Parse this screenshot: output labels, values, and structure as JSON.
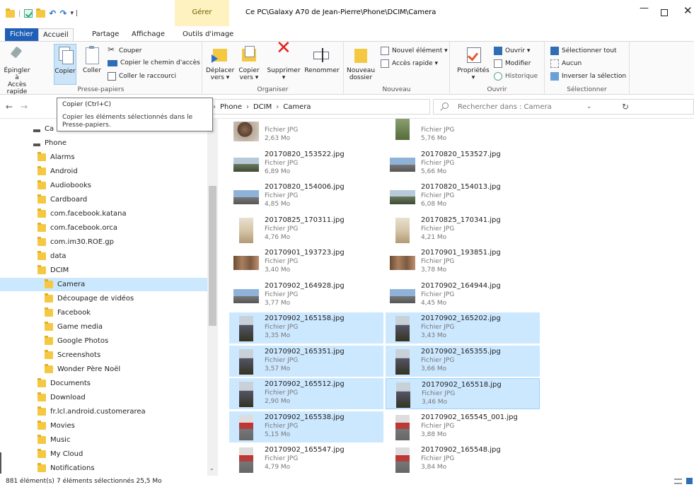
{
  "title_bar": {
    "manage_tab": "Gérer",
    "path_title": "Ce PC\\Galaxy A70 de Jean-Pierre\\Phone\\DCIM\\Camera"
  },
  "tabs": {
    "fichier": "Fichier",
    "accueil": "Accueil",
    "partage": "Partage",
    "affichage": "Affichage",
    "outils_image": "Outils d'image"
  },
  "ribbon": {
    "presse_papiers": {
      "label": "Presse-papiers",
      "epingler": "Épingler à\nAccès rapide",
      "copier": "Copier",
      "coller": "Coller",
      "couper": "Couper",
      "copier_chemin": "Copier le chemin d'accès",
      "coller_raccourci": "Coller le raccourci"
    },
    "organiser": {
      "label": "Organiser",
      "deplacer": "Déplacer\nvers ▾",
      "copier_vers": "Copier\nvers ▾",
      "supprimer": "Supprimer\n▾",
      "renommer": "Renommer"
    },
    "nouveau": {
      "label": "Nouveau",
      "nouveau_dossier": "Nouveau\ndossier",
      "nouvel_element": "Nouvel élément ▾",
      "acces_rapide": "Accès rapide ▾"
    },
    "ouvrir": {
      "label": "Ouvrir",
      "proprietes": "Propriétés\n▾",
      "ouvrir": "Ouvrir ▾",
      "modifier": "Modifier",
      "historique": "Historique"
    },
    "selectionner": {
      "label": "Sélectionner",
      "selectionner_tout": "Sélectionner tout",
      "aucun": "Aucun",
      "inverser": "Inverser la sélection"
    }
  },
  "address": {
    "crumbs": [
      "Phone",
      "DCIM",
      "Camera"
    ],
    "crumb_sep": "›",
    "lead_sep": "›",
    "search_placeholder": "Rechercher dans : Camera"
  },
  "tooltip": {
    "title": "Copier (Ctrl+C)",
    "body": "Copier les éléments sélectionnés dans le Presse-papiers."
  },
  "sidebar": {
    "items": [
      {
        "label": "Ca",
        "kind": "drive"
      },
      {
        "label": "Phone",
        "kind": "drive"
      },
      {
        "label": "Alarms",
        "kind": "folder"
      },
      {
        "label": "Android",
        "kind": "folder"
      },
      {
        "label": "Audiobooks",
        "kind": "folder"
      },
      {
        "label": "Cardboard",
        "kind": "folder"
      },
      {
        "label": "com.facebook.katana",
        "kind": "folder"
      },
      {
        "label": "com.facebook.orca",
        "kind": "folder"
      },
      {
        "label": "com.im30.ROE.gp",
        "kind": "folder"
      },
      {
        "label": "data",
        "kind": "folder"
      },
      {
        "label": "DCIM",
        "kind": "folder"
      },
      {
        "label": "Camera",
        "kind": "folder",
        "selected": true
      },
      {
        "label": "Découpage de vidéos",
        "kind": "folder"
      },
      {
        "label": "Facebook",
        "kind": "folder"
      },
      {
        "label": "Game media",
        "kind": "folder"
      },
      {
        "label": "Google Photos",
        "kind": "folder"
      },
      {
        "label": "Screenshots",
        "kind": "folder"
      },
      {
        "label": "Wonder Père Noël",
        "kind": "folder"
      },
      {
        "label": "Documents",
        "kind": "folder"
      },
      {
        "label": "Download",
        "kind": "folder"
      },
      {
        "label": "fr.lcl.android.customerarea",
        "kind": "folder"
      },
      {
        "label": "Movies",
        "kind": "folder"
      },
      {
        "label": "Music",
        "kind": "folder"
      },
      {
        "label": "My Cloud",
        "kind": "folder"
      },
      {
        "label": "Notifications",
        "kind": "folder"
      }
    ]
  },
  "files": [
    {
      "name": "",
      "type": "Fichier JPG",
      "size": "2,63 Mo",
      "thumb": "head",
      "selected": false
    },
    {
      "name": "",
      "type": "Fichier JPG",
      "size": "5,76 Mo",
      "thumb": "tall",
      "selected": false
    },
    {
      "name": "20170820_153522.jpg",
      "type": "Fichier JPG",
      "size": "6,89 Mo",
      "thumb": "land",
      "selected": false
    },
    {
      "name": "20170820_153527.jpg",
      "type": "Fichier JPG",
      "size": "5,66 Mo",
      "thumb": "land2",
      "selected": false
    },
    {
      "name": "20170820_154006.jpg",
      "type": "Fichier JPG",
      "size": "4,85 Mo",
      "thumb": "land2",
      "selected": false
    },
    {
      "name": "20170820_154013.jpg",
      "type": "Fichier JPG",
      "size": "6,08 Mo",
      "thumb": "land",
      "selected": false
    },
    {
      "name": "20170825_170311.jpg",
      "type": "Fichier JPG",
      "size": "4,76 Mo",
      "thumb": "port3",
      "selected": false
    },
    {
      "name": "20170825_170341.jpg",
      "type": "Fichier JPG",
      "size": "4,21 Mo",
      "thumb": "port3",
      "selected": false
    },
    {
      "name": "20170901_193723.jpg",
      "type": "Fichier JPG",
      "size": "3,40 Mo",
      "thumb": "people",
      "selected": false
    },
    {
      "name": "20170901_193851.jpg",
      "type": "Fichier JPG",
      "size": "3,78 Mo",
      "thumb": "people",
      "selected": false
    },
    {
      "name": "20170902_164928.jpg",
      "type": "Fichier JPG",
      "size": "3,77 Mo",
      "thumb": "land2",
      "selected": false
    },
    {
      "name": "20170902_164944.jpg",
      "type": "Fichier JPG",
      "size": "4,45 Mo",
      "thumb": "land2",
      "selected": false
    },
    {
      "name": "20170902_165158.jpg",
      "type": "Fichier JPG",
      "size": "3,35 Mo",
      "thumb": "port",
      "selected": true
    },
    {
      "name": "20170902_165202.jpg",
      "type": "Fichier JPG",
      "size": "3,43 Mo",
      "thumb": "port",
      "selected": true
    },
    {
      "name": "20170902_165351.jpg",
      "type": "Fichier JPG",
      "size": "3,57 Mo",
      "thumb": "port",
      "selected": true
    },
    {
      "name": "20170902_165355.jpg",
      "type": "Fichier JPG",
      "size": "3,66 Mo",
      "thumb": "port",
      "selected": true
    },
    {
      "name": "20170902_165512.jpg",
      "type": "Fichier JPG",
      "size": "2,90 Mo",
      "thumb": "port",
      "selected": true
    },
    {
      "name": "20170902_165518.jpg",
      "type": "Fichier JPG",
      "size": "3,46 Mo",
      "thumb": "port",
      "selected": true,
      "focus": true
    },
    {
      "name": "20170902_165538.jpg",
      "type": "Fichier JPG",
      "size": "5,15 Mo",
      "thumb": "port2",
      "selected": true
    },
    {
      "name": "20170902_165545_001.jpg",
      "type": "Fichier JPG",
      "size": "3,88 Mo",
      "thumb": "port2",
      "selected": false
    },
    {
      "name": "20170902_165547.jpg",
      "type": "Fichier JPG",
      "size": "4,79 Mo",
      "thumb": "port2",
      "selected": false
    },
    {
      "name": "20170902_165548.jpg",
      "type": "Fichier JPG",
      "size": "3,84 Mo",
      "thumb": "port2",
      "selected": false
    }
  ],
  "status": {
    "count": "881 élément(s)",
    "selection": "7 éléments sélectionnés 25,5 Mo"
  }
}
